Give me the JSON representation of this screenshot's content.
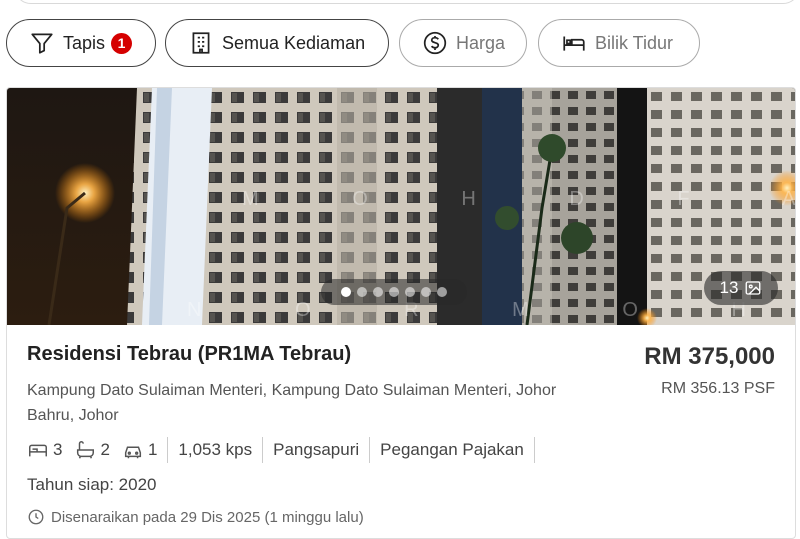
{
  "filters": {
    "tapis_label": "Tapis",
    "tapis_count": "1",
    "property_type_label": "Semua Kediaman",
    "price_label": "Harga",
    "bedroom_label": "Bilik Tidur"
  },
  "listing": {
    "title": "Residensi Tebrau (PR1MA Tebrau)",
    "address": "Kampung Dato Sulaiman Menteri, Kampung Dato Sulaiman Menteri, Johor Bahru, Johor",
    "price": "RM 375,000",
    "psf": "RM 356.13 PSF",
    "bedrooms": "3",
    "bathrooms": "2",
    "parking": "1",
    "size": "1,053 kps",
    "type": "Pangsapuri",
    "tenure": "Pegangan Pajakan",
    "completion": "Tahun siap: 2020",
    "listed": "Disenaraikan pada 29 Dis 2025 (1 minggu lalu)",
    "photo_count": "13",
    "carousel_total": 7,
    "carousel_active": 1,
    "watermark_top": "M O H D  F A E Z",
    "watermark_bottom": "N O R  M O H A M A D"
  },
  "colors": {
    "badge": "#d50000",
    "border_dark": "#444444",
    "border_muted": "#aaaaaa"
  },
  "icons": {
    "tapis": "filter-icon",
    "property_type": "building-icon",
    "price": "dollar-circle-icon",
    "bedroom": "bed-icon",
    "photos": "image-icon",
    "bed_spec": "bed-icon",
    "bath_spec": "bathtub-icon",
    "car_spec": "car-icon",
    "listed": "clock-icon"
  }
}
